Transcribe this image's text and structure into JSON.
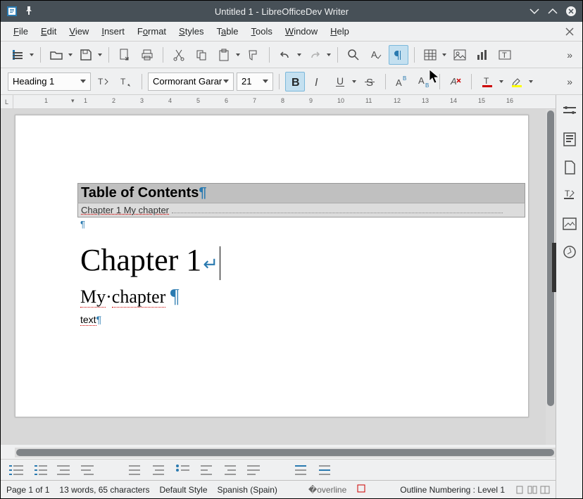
{
  "window": {
    "title": "Untitled 1 - LibreOfficeDev Writer"
  },
  "menu": {
    "file": "File",
    "edit": "Edit",
    "view": "View",
    "insert": "Insert",
    "format": "Format",
    "styles": "Styles",
    "table": "Table",
    "tools": "Tools",
    "window": "Window",
    "help": "Help"
  },
  "format_bar": {
    "style": "Heading 1",
    "font": "Cormorant Garar",
    "size": "21"
  },
  "ruler": {
    "corner": "L",
    "ticks": [
      "1",
      "1",
      "2",
      "3",
      "4",
      "5",
      "6",
      "7",
      "8",
      "9",
      "10",
      "11",
      "12",
      "13",
      "14",
      "15",
      "16"
    ]
  },
  "document": {
    "toc_title": "Table of Contents",
    "toc_entry": "Chapter 1  My chapter",
    "heading": "Chapter 1",
    "subheading": "My chapter",
    "body": "text"
  },
  "status": {
    "page": "Page 1 of 1",
    "words": "13 words, 65 characters",
    "style": "Default Style",
    "lang": "Spanish (Spain)",
    "outline": "Outline Numbering : Level 1"
  }
}
